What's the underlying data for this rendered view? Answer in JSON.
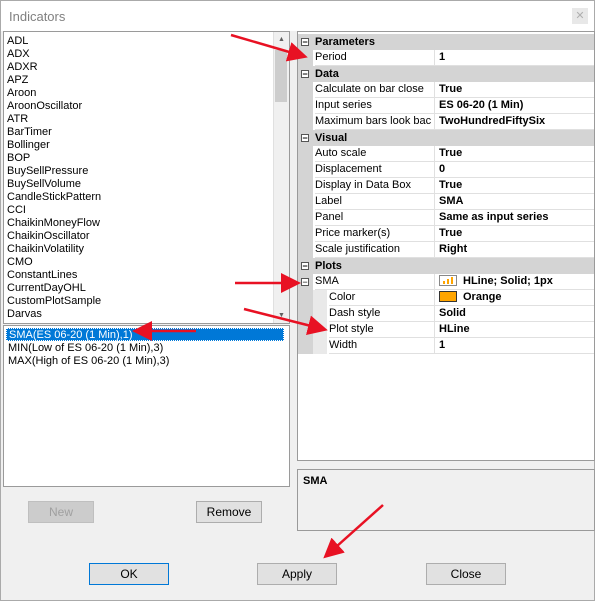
{
  "window": {
    "title": "Indicators",
    "close_glyph": "✕"
  },
  "indicator_list": {
    "items": [
      "ADL",
      "ADX",
      "ADXR",
      "APZ",
      "Aroon",
      "AroonOscillator",
      "ATR",
      "BarTimer",
      "Bollinger",
      "BOP",
      "BuySellPressure",
      "BuySellVolume",
      "CandleStickPattern",
      "CCI",
      "ChaikinMoneyFlow",
      "ChaikinOscillator",
      "ChaikinVolatility",
      "CMO",
      "ConstantLines",
      "CurrentDayOHL",
      "CustomPlotSample",
      "Darvas"
    ]
  },
  "applied": {
    "items": [
      "SMA(ES 06-20 (1 Min),1)",
      "MIN(Low of ES 06-20 (1 Min),3)",
      "MAX(High of ES 06-20 (1 Min),3)"
    ],
    "selected_index": 0
  },
  "buttons": {
    "new": "New",
    "remove": "Remove",
    "ok": "OK",
    "apply": "Apply",
    "close": "Close"
  },
  "properties": {
    "parameters": {
      "label": "Parameters",
      "period_name": "Period",
      "period_value": "1"
    },
    "data": {
      "label": "Data",
      "calc_name": "Calculate on bar close",
      "calc_value": "True",
      "input_name": "Input series",
      "input_value": "ES 06-20 (1 Min)",
      "maxbars_name": "Maximum bars look bac",
      "maxbars_value": "TwoHundredFiftySix"
    },
    "visual": {
      "label": "Visual",
      "autoscale_name": "Auto scale",
      "autoscale_value": "True",
      "displacement_name": "Displacement",
      "displacement_value": "0",
      "databox_name": "Display in Data Box",
      "databox_value": "True",
      "label_name": "Label",
      "label_value": "SMA",
      "panel_name": "Panel",
      "panel_value": "Same as input series",
      "price_name": "Price marker(s)",
      "price_value": "True",
      "scale_name": "Scale justification",
      "scale_value": "Right"
    },
    "plots": {
      "label": "Plots",
      "sma_name": "SMA",
      "sma_value": "HLine; Solid; 1px",
      "color_name": "Color",
      "color_value": "Orange",
      "color_hex": "#ffa500",
      "dash_name": "Dash style",
      "dash_value": "Solid",
      "plotstyle_name": "Plot style",
      "plotstyle_value": "HLine",
      "width_name": "Width",
      "width_value": "1"
    }
  },
  "description": {
    "text": "SMA"
  },
  "colors": {
    "selection": "#0078d7",
    "annotation_arrow": "#e81123"
  }
}
